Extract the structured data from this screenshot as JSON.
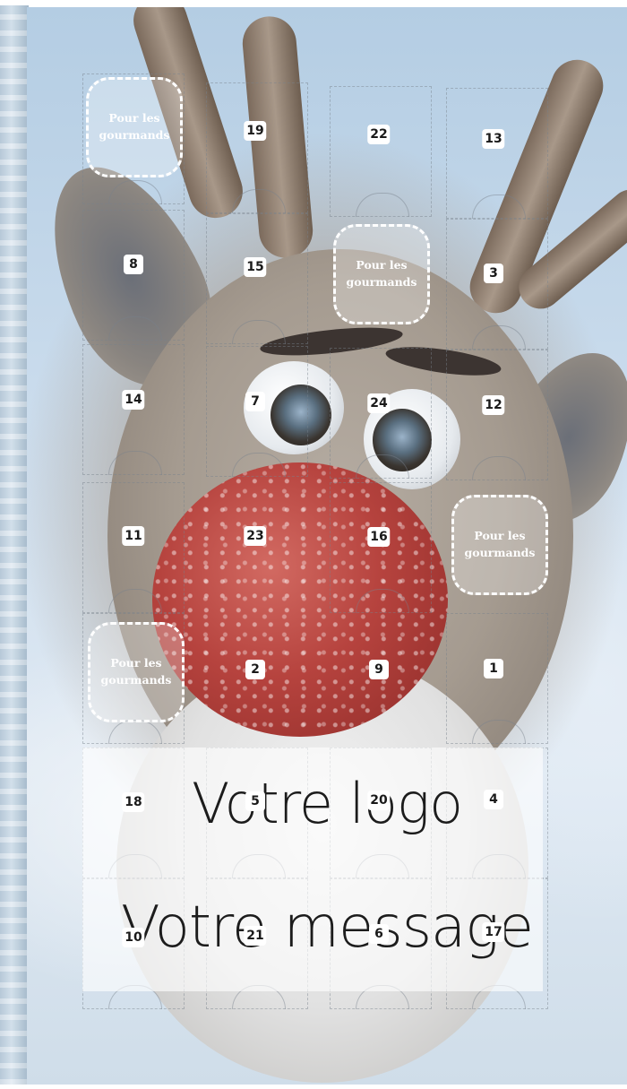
{
  "calendar": {
    "door_numbers": [
      "19",
      "22",
      "13",
      "8",
      "15",
      "3",
      "14",
      "7",
      "24",
      "12",
      "11",
      "23",
      "16",
      "2",
      "9",
      "1",
      "18",
      "5",
      "20",
      "4",
      "10",
      "21",
      "6",
      "17"
    ],
    "treat_label": "Pour les gourmands",
    "logo_placeholder": "Votre logo",
    "message_placeholder": "Votre message"
  }
}
